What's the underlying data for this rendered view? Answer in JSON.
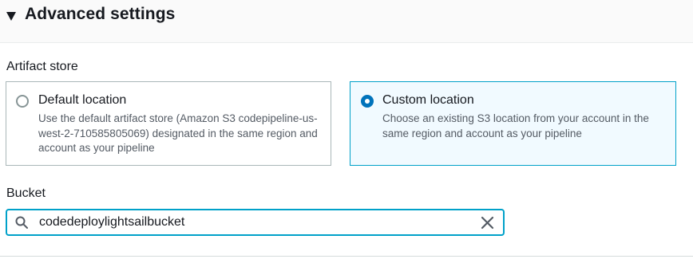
{
  "section": {
    "title": "Advanced settings",
    "caret_icon": "caret-down-icon"
  },
  "artifact_store": {
    "label": "Artifact store",
    "options": [
      {
        "title": "Default location",
        "description": "Use the default artifact store (Amazon S3 codepipeline-us-west-2-710585805069) designated in the same region and account as your pipeline",
        "selected": false
      },
      {
        "title": "Custom location",
        "description": "Choose an existing S3 location from your account in the same region and account as your pipeline",
        "selected": true
      }
    ]
  },
  "bucket": {
    "label": "Bucket",
    "value": "codedeploylightsailbucket",
    "search_icon": "search-icon",
    "clear_icon": "close-icon"
  },
  "colors": {
    "accent": "#0073bb",
    "focus_border": "#00a1c9",
    "selected_tile_bg": "#f1faff",
    "text": "#16191f",
    "secondary_text": "#545b64"
  }
}
